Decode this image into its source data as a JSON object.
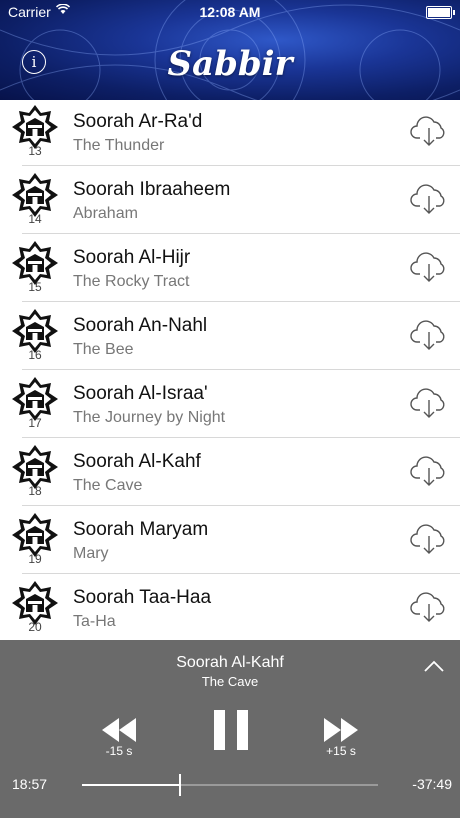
{
  "status_bar": {
    "carrier": "Carrier",
    "time": "12:08 AM",
    "battery_level": 1.0
  },
  "header": {
    "title": "Sabbir",
    "info_icon": "info-icon"
  },
  "surahs": [
    {
      "number": "13",
      "name": "Soorah Ar-Ra'd",
      "translation": "The Thunder"
    },
    {
      "number": "14",
      "name": "Soorah Ibraaheem",
      "translation": "Abraham"
    },
    {
      "number": "15",
      "name": "Soorah Al-Hijr",
      "translation": "The Rocky Tract"
    },
    {
      "number": "16",
      "name": "Soorah An-Nahl",
      "translation": "The Bee"
    },
    {
      "number": "17",
      "name": "Soorah Al-Israa'",
      "translation": "The Journey by Night"
    },
    {
      "number": "18",
      "name": "Soorah Al-Kahf",
      "translation": "The Cave"
    },
    {
      "number": "19",
      "name": "Soorah Maryam",
      "translation": "Mary"
    },
    {
      "number": "20",
      "name": "Soorah Taa-Haa",
      "translation": "Ta-Ha"
    }
  ],
  "player": {
    "title": "Soorah Al-Kahf",
    "subtitle": "The Cave",
    "rewind_label": "-15 s",
    "forward_label": "+15 s",
    "elapsed": "18:57",
    "remaining": "-37:49",
    "progress": 0.33
  },
  "colors": {
    "header_blue": "#1a3596",
    "player_bg": "#6a6a6a",
    "separator": "#d8d8d8"
  }
}
